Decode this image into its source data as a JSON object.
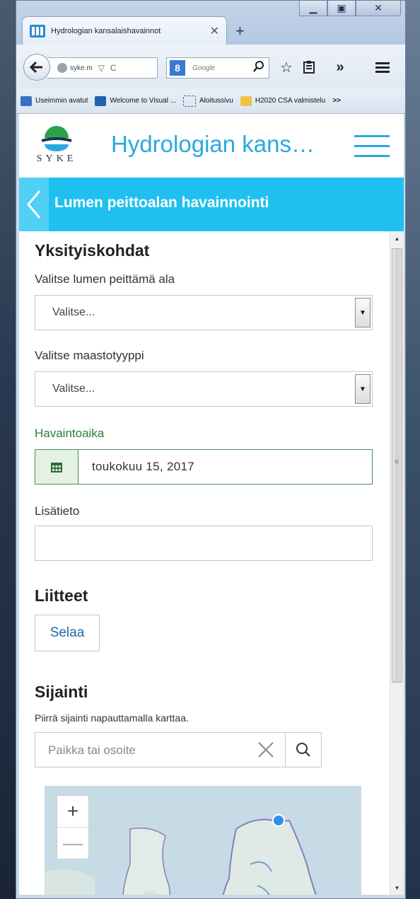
{
  "browser": {
    "tab_title": "Hydrologian kansalaishavainnot",
    "tab_close": "✕",
    "new_tab": "+",
    "url_text": "syke.m",
    "search_placeholder": "Google",
    "search_engine_badge": "8",
    "window_controls": {
      "minimize": "▁",
      "maximize": "▣",
      "close": "✕"
    },
    "overflow_chevron": "»",
    "bookmarks": [
      {
        "label": "Useimmin avatut",
        "icon": "page-icon"
      },
      {
        "label": "Welcome to Visual ...",
        "icon": "visual-studio-icon"
      },
      {
        "label": "Aloitussivu",
        "icon": "dashed-page-icon"
      },
      {
        "label": "H2020 CSA valmistelu",
        "icon": "folder-icon"
      }
    ],
    "bookmarks_overflow": ">>"
  },
  "app": {
    "logo_text": "SYKE",
    "title": "Hydrologian kans…",
    "page_title": "Lumen peittoalan havainnointi"
  },
  "form": {
    "details_heading": "Yksityiskohdat",
    "snow_cover_label": "Valitse lumen peittämä ala",
    "snow_cover_value": "Valitse...",
    "terrain_label": "Valitse maastotyyppi",
    "terrain_value": "Valitse...",
    "time_label": "Havaintoaika",
    "time_value": "toukokuu 15, 2017",
    "extra_label": "Lisätieto",
    "extra_value": "",
    "attachments_heading": "Liitteet",
    "browse_label": "Selaa",
    "location_heading": "Sijainti",
    "location_hint": "Piirrä sijainti napauttamalla karttaa.",
    "place_placeholder": "Paikka tai osoite",
    "zoom_in": "+",
    "zoom_out": "—"
  },
  "colors": {
    "accent": "#1fc0ef",
    "title_blue": "#29a9e0",
    "date_green": "#2e7d32",
    "link_blue": "#1d6aa8"
  }
}
